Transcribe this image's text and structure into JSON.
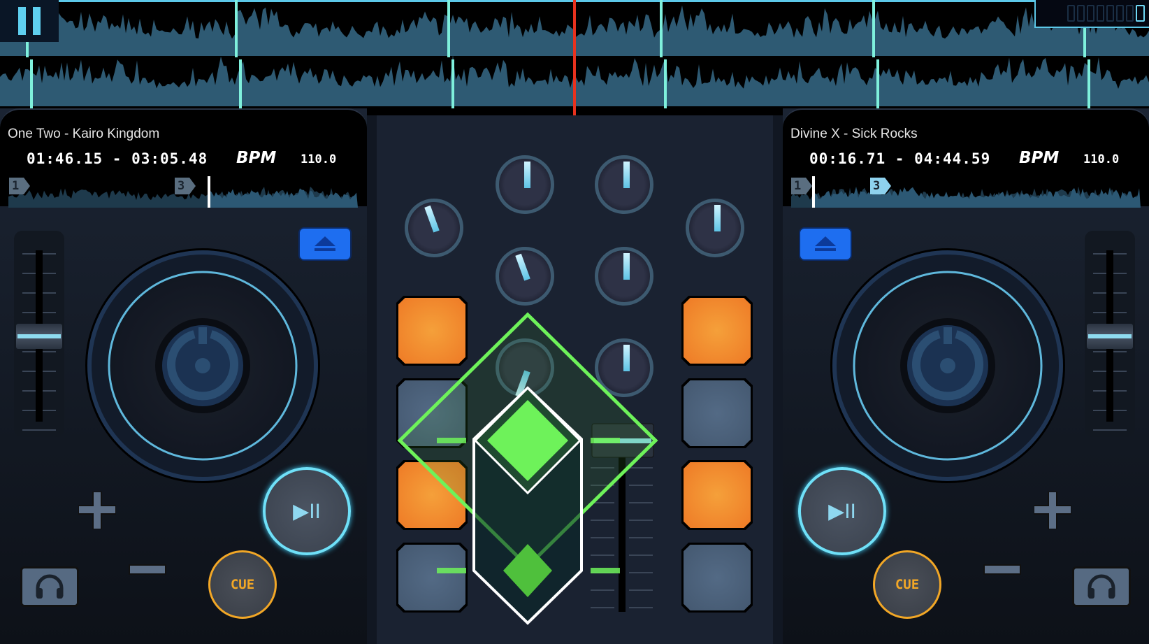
{
  "colors": {
    "accent_cyan": "#6fe0f8",
    "cue_orange": "#f2a726",
    "pad_orange": "#ee7a26",
    "pad_gray": "#4a5f78",
    "crossfade_green": "#6ef25a",
    "playhead": "#e8321e",
    "waveform": "#2e5a73",
    "eject_blue": "#1e6ef0"
  },
  "top": {
    "pause_icon": "pause-icon",
    "counter_digit": "0"
  },
  "left_deck": {
    "title": "One Two - Kairo Kingdom",
    "times": "01:46.15 - 03:05.48",
    "bpm_label": "BPM",
    "bpm_value": "110.0",
    "cue_points": [
      "1",
      "3"
    ],
    "cue_label": "CUE",
    "pitch_position": 0.5,
    "playback_progress": 0.57
  },
  "right_deck": {
    "title": "Divine X - Sick Rocks",
    "times": "00:16.71 - 04:44.59",
    "bpm_label": "BPM",
    "bpm_value": "110.0",
    "cue_points": [
      "1",
      "3"
    ],
    "cue_label": "CUE",
    "pitch_position": 0.5,
    "playback_progress": 0.06
  },
  "mixer": {
    "knobs_deg": [
      -20,
      0,
      0,
      0,
      -20,
      0,
      200,
      0
    ],
    "left_pads": [
      "orange",
      "gray",
      "orange",
      "gray"
    ],
    "right_pads": [
      "orange",
      "gray",
      "orange",
      "gray"
    ]
  },
  "icons": {
    "plus": "+",
    "minus": "−",
    "play_pause": "▶II",
    "eject": "eject-icon",
    "headphones": "headphones-icon"
  }
}
